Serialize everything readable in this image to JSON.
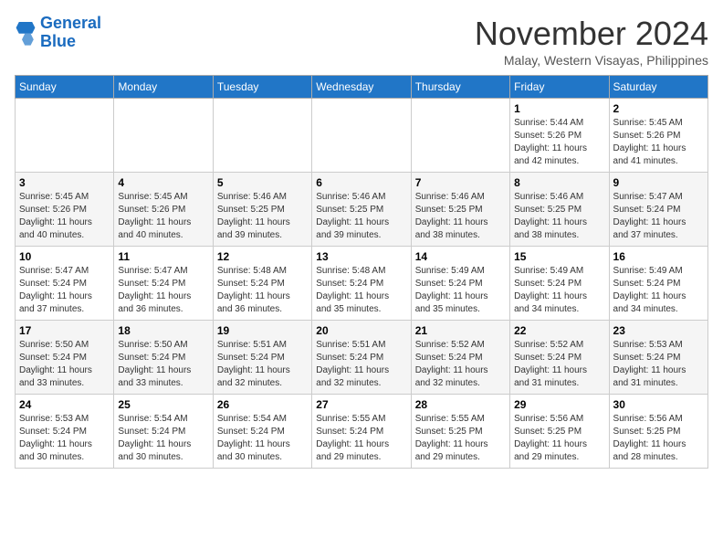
{
  "header": {
    "logo_line1": "General",
    "logo_line2": "Blue",
    "month": "November 2024",
    "location": "Malay, Western Visayas, Philippines"
  },
  "days_of_week": [
    "Sunday",
    "Monday",
    "Tuesday",
    "Wednesday",
    "Thursday",
    "Friday",
    "Saturday"
  ],
  "weeks": [
    [
      {
        "day": "",
        "info": ""
      },
      {
        "day": "",
        "info": ""
      },
      {
        "day": "",
        "info": ""
      },
      {
        "day": "",
        "info": ""
      },
      {
        "day": "",
        "info": ""
      },
      {
        "day": "1",
        "info": "Sunrise: 5:44 AM\nSunset: 5:26 PM\nDaylight: 11 hours\nand 42 minutes."
      },
      {
        "day": "2",
        "info": "Sunrise: 5:45 AM\nSunset: 5:26 PM\nDaylight: 11 hours\nand 41 minutes."
      }
    ],
    [
      {
        "day": "3",
        "info": "Sunrise: 5:45 AM\nSunset: 5:26 PM\nDaylight: 11 hours\nand 40 minutes."
      },
      {
        "day": "4",
        "info": "Sunrise: 5:45 AM\nSunset: 5:26 PM\nDaylight: 11 hours\nand 40 minutes."
      },
      {
        "day": "5",
        "info": "Sunrise: 5:46 AM\nSunset: 5:25 PM\nDaylight: 11 hours\nand 39 minutes."
      },
      {
        "day": "6",
        "info": "Sunrise: 5:46 AM\nSunset: 5:25 PM\nDaylight: 11 hours\nand 39 minutes."
      },
      {
        "day": "7",
        "info": "Sunrise: 5:46 AM\nSunset: 5:25 PM\nDaylight: 11 hours\nand 38 minutes."
      },
      {
        "day": "8",
        "info": "Sunrise: 5:46 AM\nSunset: 5:25 PM\nDaylight: 11 hours\nand 38 minutes."
      },
      {
        "day": "9",
        "info": "Sunrise: 5:47 AM\nSunset: 5:24 PM\nDaylight: 11 hours\nand 37 minutes."
      }
    ],
    [
      {
        "day": "10",
        "info": "Sunrise: 5:47 AM\nSunset: 5:24 PM\nDaylight: 11 hours\nand 37 minutes."
      },
      {
        "day": "11",
        "info": "Sunrise: 5:47 AM\nSunset: 5:24 PM\nDaylight: 11 hours\nand 36 minutes."
      },
      {
        "day": "12",
        "info": "Sunrise: 5:48 AM\nSunset: 5:24 PM\nDaylight: 11 hours\nand 36 minutes."
      },
      {
        "day": "13",
        "info": "Sunrise: 5:48 AM\nSunset: 5:24 PM\nDaylight: 11 hours\nand 35 minutes."
      },
      {
        "day": "14",
        "info": "Sunrise: 5:49 AM\nSunset: 5:24 PM\nDaylight: 11 hours\nand 35 minutes."
      },
      {
        "day": "15",
        "info": "Sunrise: 5:49 AM\nSunset: 5:24 PM\nDaylight: 11 hours\nand 34 minutes."
      },
      {
        "day": "16",
        "info": "Sunrise: 5:49 AM\nSunset: 5:24 PM\nDaylight: 11 hours\nand 34 minutes."
      }
    ],
    [
      {
        "day": "17",
        "info": "Sunrise: 5:50 AM\nSunset: 5:24 PM\nDaylight: 11 hours\nand 33 minutes."
      },
      {
        "day": "18",
        "info": "Sunrise: 5:50 AM\nSunset: 5:24 PM\nDaylight: 11 hours\nand 33 minutes."
      },
      {
        "day": "19",
        "info": "Sunrise: 5:51 AM\nSunset: 5:24 PM\nDaylight: 11 hours\nand 32 minutes."
      },
      {
        "day": "20",
        "info": "Sunrise: 5:51 AM\nSunset: 5:24 PM\nDaylight: 11 hours\nand 32 minutes."
      },
      {
        "day": "21",
        "info": "Sunrise: 5:52 AM\nSunset: 5:24 PM\nDaylight: 11 hours\nand 32 minutes."
      },
      {
        "day": "22",
        "info": "Sunrise: 5:52 AM\nSunset: 5:24 PM\nDaylight: 11 hours\nand 31 minutes."
      },
      {
        "day": "23",
        "info": "Sunrise: 5:53 AM\nSunset: 5:24 PM\nDaylight: 11 hours\nand 31 minutes."
      }
    ],
    [
      {
        "day": "24",
        "info": "Sunrise: 5:53 AM\nSunset: 5:24 PM\nDaylight: 11 hours\nand 30 minutes."
      },
      {
        "day": "25",
        "info": "Sunrise: 5:54 AM\nSunset: 5:24 PM\nDaylight: 11 hours\nand 30 minutes."
      },
      {
        "day": "26",
        "info": "Sunrise: 5:54 AM\nSunset: 5:24 PM\nDaylight: 11 hours\nand 30 minutes."
      },
      {
        "day": "27",
        "info": "Sunrise: 5:55 AM\nSunset: 5:24 PM\nDaylight: 11 hours\nand 29 minutes."
      },
      {
        "day": "28",
        "info": "Sunrise: 5:55 AM\nSunset: 5:25 PM\nDaylight: 11 hours\nand 29 minutes."
      },
      {
        "day": "29",
        "info": "Sunrise: 5:56 AM\nSunset: 5:25 PM\nDaylight: 11 hours\nand 29 minutes."
      },
      {
        "day": "30",
        "info": "Sunrise: 5:56 AM\nSunset: 5:25 PM\nDaylight: 11 hours\nand 28 minutes."
      }
    ]
  ]
}
